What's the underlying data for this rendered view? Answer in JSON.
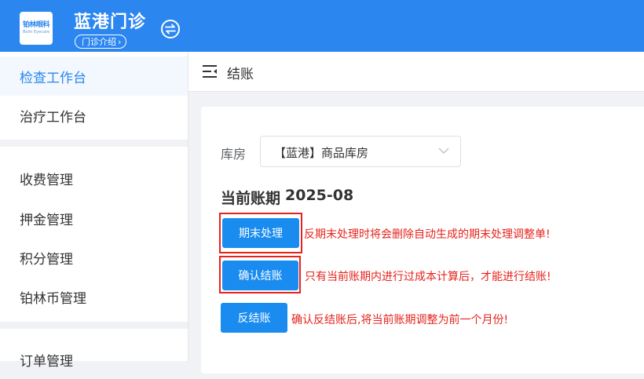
{
  "header": {
    "logo_cn": "铂林眼科",
    "logo_en": "Bolin Eyecare",
    "clinic_name": "蓝港门诊",
    "intro_button": "门诊介绍",
    "intro_chevron": "›"
  },
  "sidebar": {
    "items": [
      {
        "label": "检查工作台",
        "active": true
      },
      {
        "label": "治疗工作台",
        "active": false
      },
      {
        "label": "收费管理",
        "active": false
      },
      {
        "label": "押金管理",
        "active": false
      },
      {
        "label": "积分管理",
        "active": false
      },
      {
        "label": "铂林币管理",
        "active": false
      },
      {
        "label": "订单管理",
        "active": false
      }
    ]
  },
  "topbar": {
    "title": "结账"
  },
  "form": {
    "warehouse_label": "库房",
    "warehouse_value": "【蓝港】商品库房",
    "period_label": "当前账期",
    "period_value": "2025-08"
  },
  "actions": [
    {
      "label": "期末处理",
      "note": "反期末处理时将会删除自动生成的期末处理调整单!",
      "highlighted": true
    },
    {
      "label": "确认结账",
      "note": "只有当前账期内进行过成本计算后，才能进行结账!",
      "highlighted": true
    },
    {
      "label": "反结账",
      "note": "确认反结账后,将当前账期调整为前一个月份!",
      "highlighted": false
    }
  ],
  "colors": {
    "primary": "#2b86f0",
    "button": "#1a8cf0",
    "warning": "#e5231c"
  }
}
